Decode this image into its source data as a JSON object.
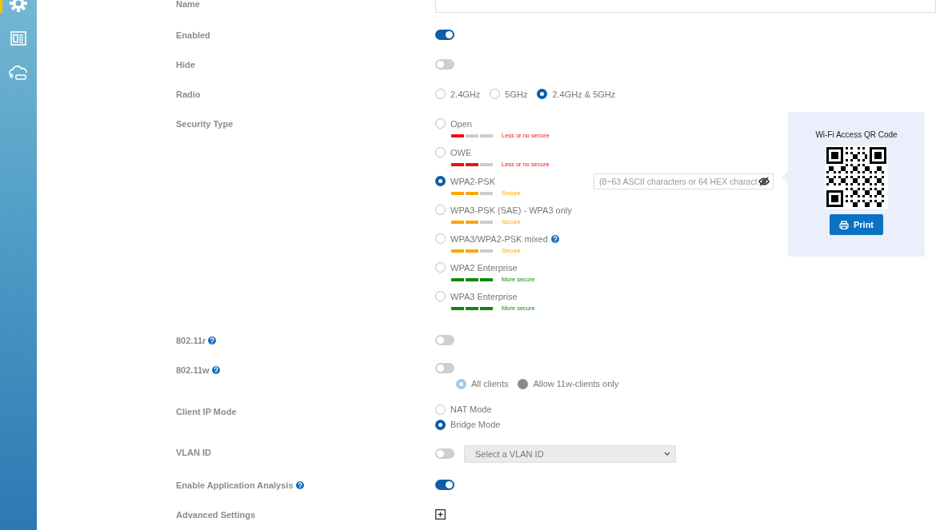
{
  "sidebar": {
    "items": [
      {
        "kind": "gear",
        "selected": true
      },
      {
        "kind": "document",
        "selected": false
      },
      {
        "kind": "cloud",
        "selected": false
      }
    ]
  },
  "rows": [
    {
      "kind": "input",
      "label": "Name"
    },
    {
      "kind": "toggle",
      "label": "Enabled",
      "on": true
    },
    {
      "kind": "toggle",
      "label": "Hide",
      "on": false
    },
    {
      "kind": "radio-inline",
      "label": "Radio",
      "options": [
        {
          "label": "2.4GHz",
          "selected": false
        },
        {
          "label": "5GHz",
          "selected": false
        },
        {
          "label": "2.4GHz & 5GHz",
          "selected": true
        }
      ]
    },
    {
      "kind": "security",
      "label": "Security Type",
      "password": {
        "placeholder": "(8~63 ASCII characters or 64 HEX charact"
      },
      "options": [
        {
          "label": "Open",
          "selected": false,
          "level": 0.33,
          "color": "#ee1111",
          "rating": "Less or no secure"
        },
        {
          "label": "OWE",
          "selected": false,
          "level": 0.67,
          "color": "#ee1111",
          "rating": "Less or no secure"
        },
        {
          "label": "WPA2-PSK",
          "selected": true,
          "level": 0.67,
          "color": "#ffa500",
          "rating": "Secure"
        },
        {
          "label": "WPA3-PSK (SAE) - WPA3 only",
          "selected": false,
          "level": 0.67,
          "color": "#ffa500",
          "rating": "Secure"
        },
        {
          "label": "WPA3/WPA2-PSK mixed",
          "selected": false,
          "help": true,
          "level": 0.67,
          "color": "#ffa500",
          "rating": "Secure"
        },
        {
          "label": "WPA2 Enterprise",
          "selected": false,
          "level": 1,
          "color": "#118811",
          "rating": "More secure"
        },
        {
          "label": "WPA3 Enterprise",
          "selected": false,
          "level": 1,
          "color": "#118811",
          "rating": "More secure"
        }
      ]
    },
    {
      "kind": "toggle",
      "label": "802.11r",
      "help": true,
      "on": false
    },
    {
      "kind": "toggle",
      "label": "802.11w",
      "help": true,
      "on": false,
      "sub_disabled": true,
      "sub_options": [
        {
          "label": "All clients",
          "selected": true
        },
        {
          "label": "Allow 11w-clients only",
          "selected": false
        }
      ]
    },
    {
      "kind": "radio-stack",
      "label": "Client IP Mode",
      "options": [
        {
          "label": "NAT Mode",
          "selected": false
        },
        {
          "label": "Bridge Mode",
          "selected": true
        }
      ]
    },
    {
      "kind": "toggle-select",
      "label": "VLAN ID",
      "on": false,
      "select": {
        "placeholder": "Select a VLAN ID"
      }
    },
    {
      "kind": "toggle",
      "label": "Enable Application Analysis",
      "help": true,
      "on": true
    },
    {
      "kind": "expand",
      "label": "Advanced Settings",
      "expanded": false
    }
  ],
  "qr_panel": {
    "title": "Wi-Fi Access QR Code",
    "button": "Print"
  }
}
